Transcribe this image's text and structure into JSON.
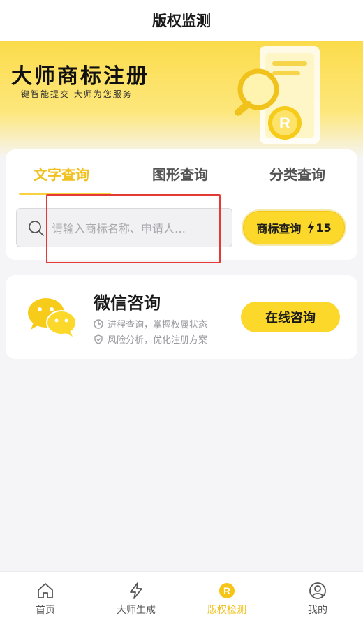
{
  "header": {
    "title": "版权监测"
  },
  "banner": {
    "title": "大师商标注册",
    "subtitle": "一键智能提交 大师为您服务",
    "illustration_icon": "trademark-magnifier-illustration"
  },
  "search": {
    "tabs": [
      {
        "label": "文字查询",
        "active": true
      },
      {
        "label": "图形查询",
        "active": false
      },
      {
        "label": "分类查询",
        "active": false
      }
    ],
    "placeholder": "请输入商标名称、申请人…",
    "value": "",
    "button_label": "商标查询",
    "button_credit": "15",
    "button_icon": "bolt-icon"
  },
  "wechat": {
    "title": "微信咨询",
    "features": [
      {
        "icon": "clock-icon",
        "text": "进程查询，掌握权属状态"
      },
      {
        "icon": "shield-icon",
        "text": "风险分析，优化注册方案"
      }
    ],
    "button_label": "在线咨询"
  },
  "tabbar": {
    "items": [
      {
        "label": "首页",
        "icon": "home-icon",
        "active": false
      },
      {
        "label": "大师生成",
        "icon": "bolt-icon",
        "active": false
      },
      {
        "label": "版权检测",
        "icon": "trademark-r-icon",
        "active": true
      },
      {
        "label": "我的",
        "icon": "user-icon",
        "active": false
      }
    ]
  },
  "colors": {
    "accent": "#fbd829",
    "active_text": "#f0c11f",
    "highlight": "#e53935",
    "background": "#f5f5f7"
  }
}
